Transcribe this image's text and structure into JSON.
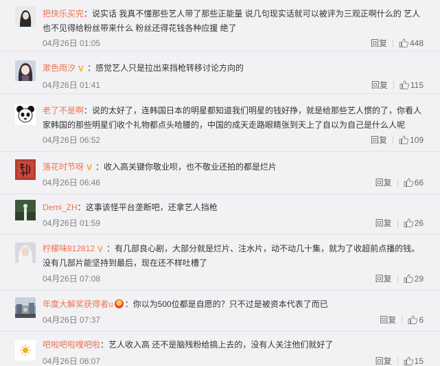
{
  "comments": [
    {
      "username": "把快乐买完",
      "badge": "",
      "text": "说实话 我真不懂那些艺人带了那些正能量 说几句现实话就可以被评为三观正啊什么的 艺人也不见得给粉丝带来什么 粉丝还得花钱各种应援 绝了",
      "time": "04月26日 01:05",
      "reply_label": "回复",
      "likes": "448",
      "avatar": "girl-dark-hair"
    },
    {
      "username": "漱色雨汐",
      "badge": "V",
      "text": "感觉艺人只是拉出来挡枪转移讨论方向的",
      "time": "04月26日 01:41",
      "reply_label": "回复",
      "likes": "115",
      "avatar": "anime-girl"
    },
    {
      "username": "老了不是啊",
      "badge": "",
      "text": "说的太好了，连韩国日本的明星都知道我们明星的钱好挣，就是给那些艺人惯的了，你看人家韩国的那些明星们收个礼物都点头哈腰的，中国的成天走路眼睛张到天上了自以为自己是什么人呢",
      "time": "04月26日 06:52",
      "reply_label": "回复",
      "likes": "109",
      "avatar": "panda"
    },
    {
      "username": "落花时节呀",
      "badge": "V",
      "text": "收入高关键你敬业呗，也不敬业还拍的都是烂片",
      "time": "04月26日 06:46",
      "reply_label": "回复",
      "likes": "66",
      "avatar": "red-calligraphy"
    },
    {
      "username": "Demi_ZH",
      "badge": "",
      "text": "这事该怪平台垄断吧，还拿艺人挡枪",
      "time": "04月26日 01:59",
      "reply_label": "回复",
      "likes": "26",
      "avatar": "green-figure"
    },
    {
      "username": "柠檬味812812",
      "badge": "V",
      "text": "有几部良心剧，大部分就是烂片、注水片，动不动几十集，就为了收超前点播的钱。没有几部片能坚持到最后，现在还不样吐槽了",
      "time": "04月26日 07:08",
      "reply_label": "回复",
      "likes": "29",
      "avatar": "white-hair-girl"
    },
    {
      "username": "年度大解奖获得者u",
      "badge": "medal",
      "text": "你以为500位都是自愿的？只不过是被资本代表了而已",
      "time": "04月26日 07:37",
      "reply_label": "回复",
      "likes": "6",
      "avatar": "street-scene"
    },
    {
      "username": "吧啦吧啦哩吧啦",
      "badge": "",
      "text": "艺人收入高 还不是脑残粉给搞上去的，没有人关注他们就好了",
      "time": "04月26日 06:07",
      "reply_label": "回复",
      "likes": "15",
      "avatar": "small-sun"
    }
  ],
  "colors": {
    "username": "#eb7350",
    "badge_v": "#f5a623",
    "background": "#f2f2f5",
    "meta": "#808080"
  },
  "icons": {
    "like": "thumbs-up-icon",
    "verified": "v-badge-icon",
    "medal": "medal-icon"
  }
}
